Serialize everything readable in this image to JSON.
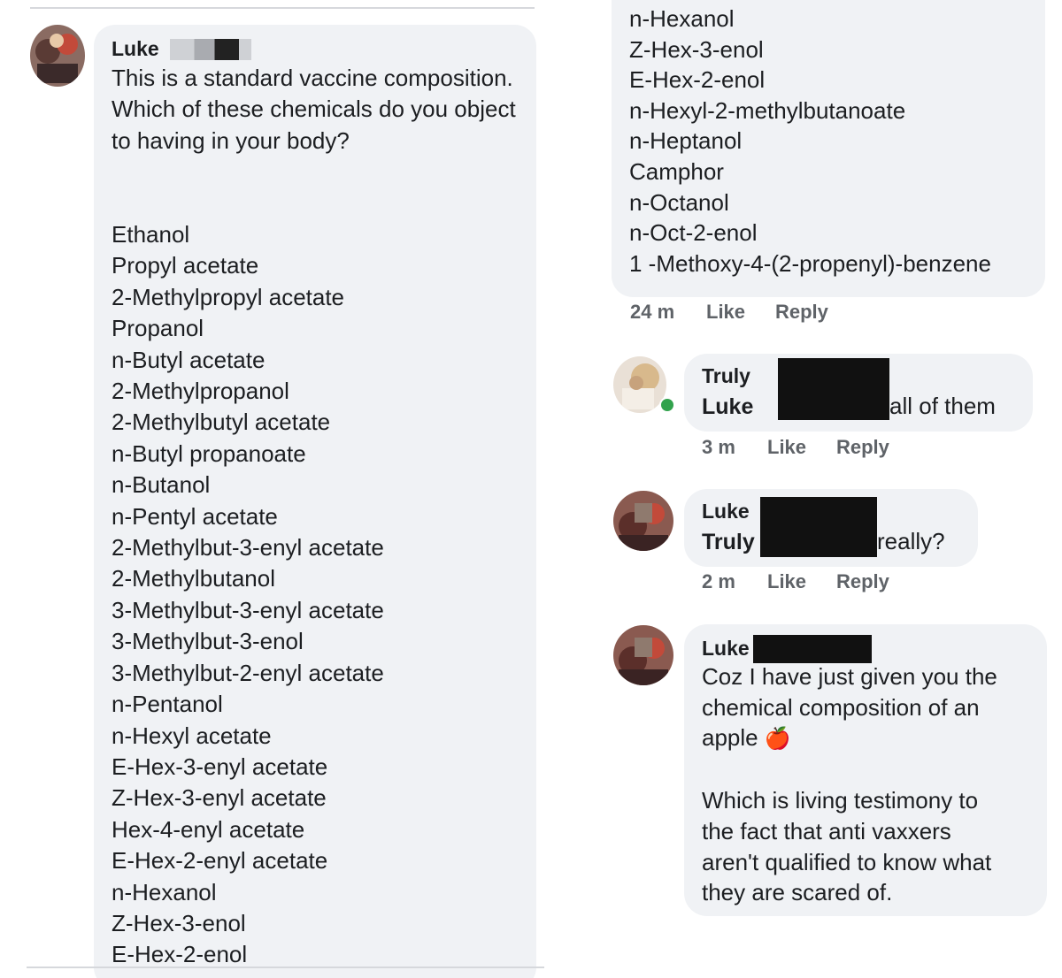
{
  "left_comment": {
    "author": "Luke",
    "question": "This is a standard vaccine composition. Which of these chemicals do you object to having in your body?",
    "chemicals": [
      "Ethanol",
      "Propyl acetate",
      "2-Methylpropyl acetate",
      "Propanol",
      "n-Butyl acetate",
      "2-Methylpropanol",
      "2-Methylbutyl acetate",
      "n-Butyl propanoate",
      "n-Butanol",
      "n-Pentyl acetate",
      "2-Methylbut-3-enyl acetate",
      "2-Methylbutanol",
      "3-Methylbut-3-enyl acetate",
      "3-Methylbut-3-enol",
      "3-Methylbut-2-enyl acetate",
      "n-Pentanol",
      "n-Hexyl acetate",
      "E-Hex-3-enyl acetate",
      "Z-Hex-3-enyl acetate",
      "Hex-4-enyl acetate",
      "E-Hex-2-enyl acetate",
      "n-Hexanol",
      "Z-Hex-3-enol",
      "E-Hex-2-enol"
    ]
  },
  "right_continuation": {
    "chemicals": [
      "n-Hexanol",
      "Z-Hex-3-enol",
      "E-Hex-2-enol",
      "n-Hexyl-2-methylbutanoate",
      "n-Heptanol",
      "Camphor",
      "n-Octanol",
      "n-Oct-2-enol",
      "1 -Methoxy-4-(2-propenyl)-benzene"
    ],
    "time": "24 m",
    "like": "Like",
    "reply": "Reply"
  },
  "reply_truly": {
    "author": "Truly",
    "mention": "Luke",
    "text": "all of them",
    "time": "3 m",
    "like": "Like",
    "reply": "Reply"
  },
  "reply_luke_1": {
    "author": "Luke",
    "mention": "Truly",
    "text": "really?",
    "time": "2 m",
    "like": "Like",
    "reply": "Reply"
  },
  "reply_luke_2": {
    "author": "Luke",
    "line1": "Coz I have just given you the",
    "line2": "chemical composition of an",
    "line3": "apple",
    "apple_emoji": "🍎",
    "para2": [
      "Which is living testimony to",
      "the fact that anti vaxxers",
      "aren't qualified to know what",
      "they are scared of."
    ]
  }
}
